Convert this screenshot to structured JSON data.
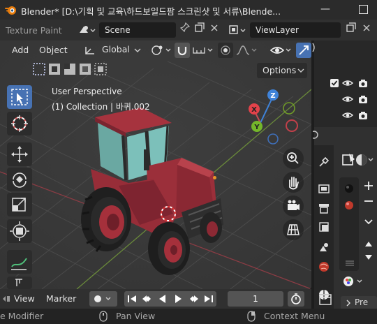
{
  "window": {
    "title": "Blender* [D:\\기획 및 교육\\하드보일드팜 스크린샷 및 서류\\Blende...",
    "minimize_glyph": "—"
  },
  "topbar": {
    "workspace_tab": "Texture Paint",
    "scene_name": "Scene",
    "view_layer": "ViewLayer"
  },
  "viewport": {
    "menu": [
      "Add",
      "Object"
    ],
    "transform_orientation": "Global",
    "options_label": "Options",
    "perspective_label": "User Perspective",
    "collection_label": "(1) Collection | 바퀴.002",
    "gizmo_axes": {
      "x": "X",
      "y": "Y",
      "z": "Z"
    }
  },
  "timeline": {
    "menu": [
      "View",
      "Marker"
    ],
    "current_frame": "1"
  },
  "statusbar": {
    "left": "e Modifier",
    "middle": "Pan View",
    "right": "Context Menu"
  },
  "properties": {
    "tab_label": "Pre"
  },
  "colors": {
    "accent": "#4772b3",
    "axis_x": "#e2424a",
    "axis_y": "#74b72a",
    "axis_z": "#3f83d9",
    "tractor_red": "#a0313d",
    "cab_glass": "#6fb8b0"
  }
}
